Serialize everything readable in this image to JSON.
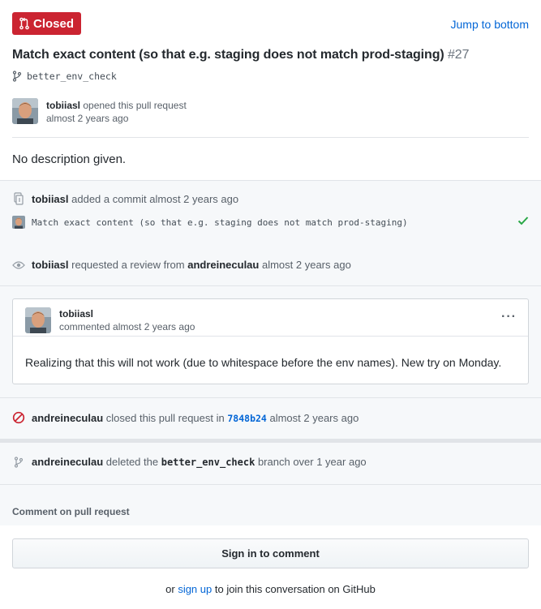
{
  "header": {
    "status_label": "Closed",
    "jump_label": "Jump to bottom",
    "status_color": "#cb2431"
  },
  "pr": {
    "title": "Match exact content (so that e.g. staging does not match prod-staging)",
    "number": "#27",
    "branch": "better_env_check"
  },
  "opener": {
    "user": "tobiiasl",
    "action": "opened this pull request",
    "time": "almost 2 years ago"
  },
  "description": "No description given.",
  "timeline": {
    "commit_event": {
      "user": "tobiiasl",
      "action": "added a commit",
      "time": "almost 2 years ago"
    },
    "commit": {
      "message": "Match exact content (so that e.g. staging does not match prod-staging)",
      "status": "success"
    },
    "review_event": {
      "user": "tobiiasl",
      "action": "requested a review from",
      "reviewer": "andreineculau",
      "time": "almost 2 years ago"
    },
    "comment": {
      "author": "tobiiasl",
      "meta": "commented almost 2 years ago",
      "more_label": "···",
      "body": "Realizing that this will not work (due to whitespace before the env names). New try on Monday."
    },
    "close_event": {
      "user": "andreineculau",
      "action": "closed this pull request in",
      "sha": "7848b24",
      "time": "almost 2 years ago"
    },
    "delete_event": {
      "user": "andreineculau",
      "action": "deleted the",
      "branch": "better_env_check",
      "suffix": "branch over 1 year ago"
    }
  },
  "footer": {
    "comment_label": "Comment on pull request",
    "signin_label": "Sign in to comment",
    "signup_prefix": "or",
    "signup_link": "sign up",
    "signup_suffix": "to join this conversation on GitHub"
  },
  "icons": {
    "status": "pull-request-icon",
    "branch": "git-branch-icon",
    "commit": "git-commit-icon",
    "review": "eye-icon",
    "closed": "circle-slash-icon",
    "check": "check-icon"
  }
}
